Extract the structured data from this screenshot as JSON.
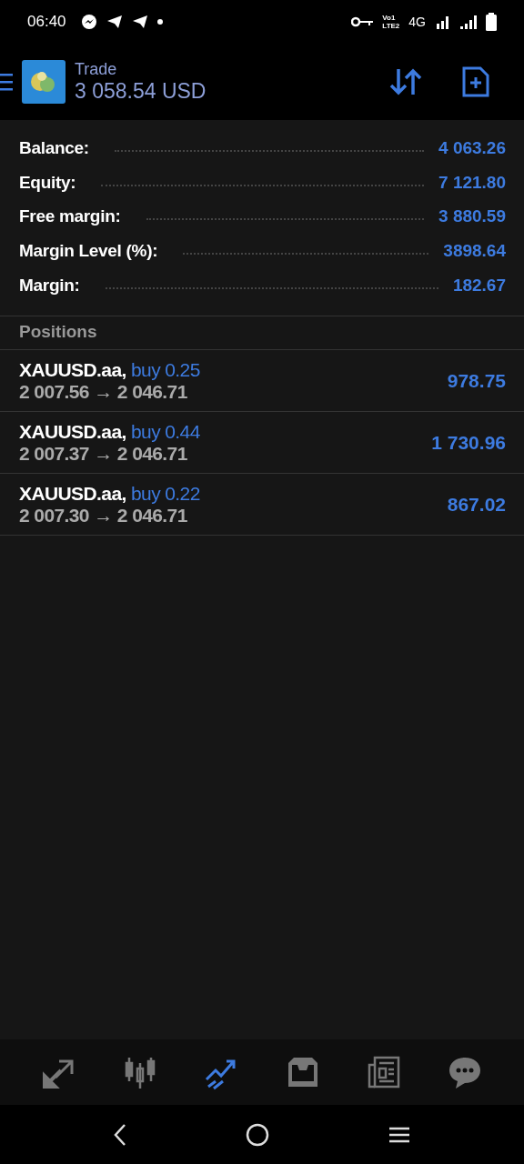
{
  "status_bar": {
    "time": "06:40",
    "volte_top": "Vo1",
    "volte_bottom": "LTE2",
    "network": "4G"
  },
  "header": {
    "title": "Trade",
    "balance": "3 058.54 USD"
  },
  "summary": [
    {
      "label": "Balance:",
      "value": "4 063.26"
    },
    {
      "label": "Equity:",
      "value": "7 121.80"
    },
    {
      "label": "Free margin:",
      "value": "3 880.59"
    },
    {
      "label": "Margin Level (%):",
      "value": "3898.64"
    },
    {
      "label": "Margin:",
      "value": "182.67"
    }
  ],
  "positions_heading": "Positions",
  "positions": [
    {
      "symbol": "XAUUSD.aa,",
      "order": "buy 0.25",
      "prices": "2 007.56 → 2 046.71",
      "profit": "978.75"
    },
    {
      "symbol": "XAUUSD.aa,",
      "order": "buy 0.44",
      "prices": "2 007.37 → 2 046.71",
      "profit": "1 730.96"
    },
    {
      "symbol": "XAUUSD.aa,",
      "order": "buy 0.22",
      "prices": "2 007.30 → 2 046.71",
      "profit": "867.02"
    }
  ],
  "bottom_nav": [
    {
      "kind": "quotes",
      "selected": false
    },
    {
      "kind": "chart",
      "selected": false
    },
    {
      "kind": "trade",
      "selected": true
    },
    {
      "kind": "history",
      "selected": false
    },
    {
      "kind": "news",
      "selected": false
    },
    {
      "kind": "messages",
      "selected": false
    }
  ]
}
